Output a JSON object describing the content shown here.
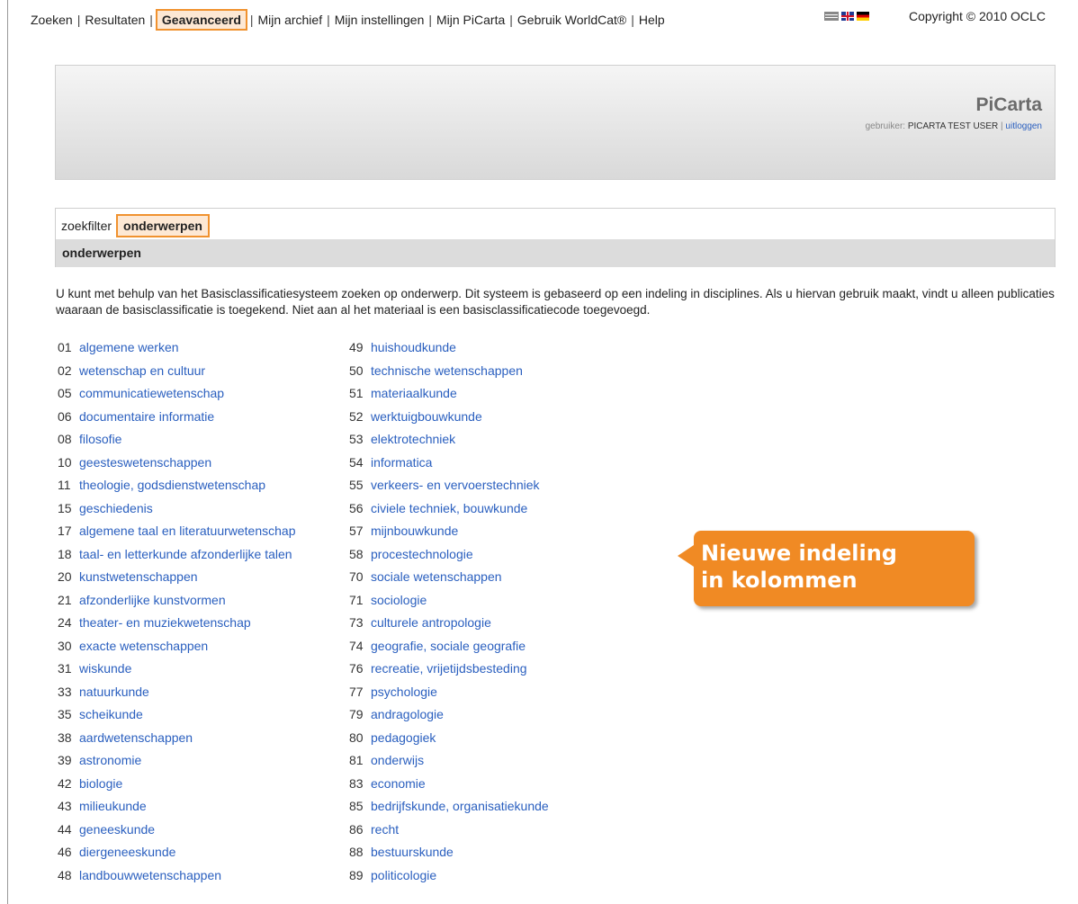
{
  "nav": {
    "items": [
      "Zoeken",
      "Resultaten",
      "Geavanceerd",
      "Mijn archief",
      "Mijn instellingen",
      "Mijn PiCarta",
      "Gebruik WorldCat®",
      "Help"
    ],
    "active": "Geavanceerd",
    "separator": "|"
  },
  "flags": [
    "nl-flag-icon",
    "uk-flag-icon",
    "de-flag-icon"
  ],
  "copyright": "Copyright © 2010 OCLC",
  "header": {
    "brand": "PiCarta",
    "user_label": "gebruiker:",
    "user_name": "PICARTA TEST USER",
    "separator": "|",
    "logout": "uitloggen"
  },
  "filter": {
    "label": "zoekfilter",
    "active": "onderwerpen",
    "section_title": "onderwerpen"
  },
  "intro": "U kunt met behulp van het Basisclassificatiesysteem zoeken op onderwerp. Dit systeem is gebaseerd op een indeling in disciplines. Als u hiervan gebruik maakt, vindt u alleen publicaties waaraan de basisclassificatie is toegekend. Niet aan al het materiaal is een basisclassificatiecode toegevoegd.",
  "subjects_col1": [
    {
      "code": "01",
      "label": "algemene werken"
    },
    {
      "code": "02",
      "label": "wetenschap en cultuur"
    },
    {
      "code": "05",
      "label": "communicatiewetenschap"
    },
    {
      "code": "06",
      "label": "documentaire informatie"
    },
    {
      "code": "08",
      "label": "filosofie"
    },
    {
      "code": "10",
      "label": "geesteswetenschappen"
    },
    {
      "code": "11",
      "label": "theologie, godsdienstwetenschap"
    },
    {
      "code": "15",
      "label": "geschiedenis"
    },
    {
      "code": "17",
      "label": "algemene taal en literatuurwetenschap"
    },
    {
      "code": "18",
      "label": "taal- en letterkunde afzonderlijke talen"
    },
    {
      "code": "20",
      "label": "kunstwetenschappen"
    },
    {
      "code": "21",
      "label": "afzonderlijke kunstvormen"
    },
    {
      "code": "24",
      "label": "theater- en muziekwetenschap"
    },
    {
      "code": "30",
      "label": "exacte wetenschappen"
    },
    {
      "code": "31",
      "label": "wiskunde"
    },
    {
      "code": "33",
      "label": "natuurkunde"
    },
    {
      "code": "35",
      "label": "scheikunde"
    },
    {
      "code": "38",
      "label": "aardwetenschappen"
    },
    {
      "code": "39",
      "label": "astronomie"
    },
    {
      "code": "42",
      "label": "biologie"
    },
    {
      "code": "43",
      "label": "milieukunde"
    },
    {
      "code": "44",
      "label": "geneeskunde"
    },
    {
      "code": "46",
      "label": "diergeneeskunde"
    },
    {
      "code": "48",
      "label": "landbouwwetenschappen"
    }
  ],
  "subjects_col2": [
    {
      "code": "49",
      "label": "huishoudkunde"
    },
    {
      "code": "50",
      "label": "technische wetenschappen"
    },
    {
      "code": "51",
      "label": "materiaalkunde"
    },
    {
      "code": "52",
      "label": "werktuigbouwkunde"
    },
    {
      "code": "53",
      "label": "elektrotechniek"
    },
    {
      "code": "54",
      "label": "informatica"
    },
    {
      "code": "55",
      "label": "verkeers- en vervoerstechniek"
    },
    {
      "code": "56",
      "label": "civiele techniek, bouwkunde"
    },
    {
      "code": "57",
      "label": "mijnbouwkunde"
    },
    {
      "code": "58",
      "label": "procestechnologie"
    },
    {
      "code": "70",
      "label": "sociale wetenschappen"
    },
    {
      "code": "71",
      "label": "sociologie"
    },
    {
      "code": "73",
      "label": "culturele antropologie"
    },
    {
      "code": "74",
      "label": "geografie, sociale geografie"
    },
    {
      "code": "76",
      "label": "recreatie, vrijetijdsbesteding"
    },
    {
      "code": "77",
      "label": "psychologie"
    },
    {
      "code": "79",
      "label": "andragologie"
    },
    {
      "code": "80",
      "label": "pedagogiek"
    },
    {
      "code": "81",
      "label": "onderwijs"
    },
    {
      "code": "83",
      "label": "economie"
    },
    {
      "code": "85",
      "label": "bedrijfskunde, organisatiekunde"
    },
    {
      "code": "86",
      "label": "recht"
    },
    {
      "code": "88",
      "label": "bestuurskunde"
    },
    {
      "code": "89",
      "label": "politicologie"
    }
  ],
  "callout": {
    "line1": "Nieuwe indeling",
    "line2": "in kolommen"
  },
  "colors": {
    "link": "#2a5fbf",
    "accent": "#f08a24",
    "highlight_bg": "#fde8d4"
  }
}
